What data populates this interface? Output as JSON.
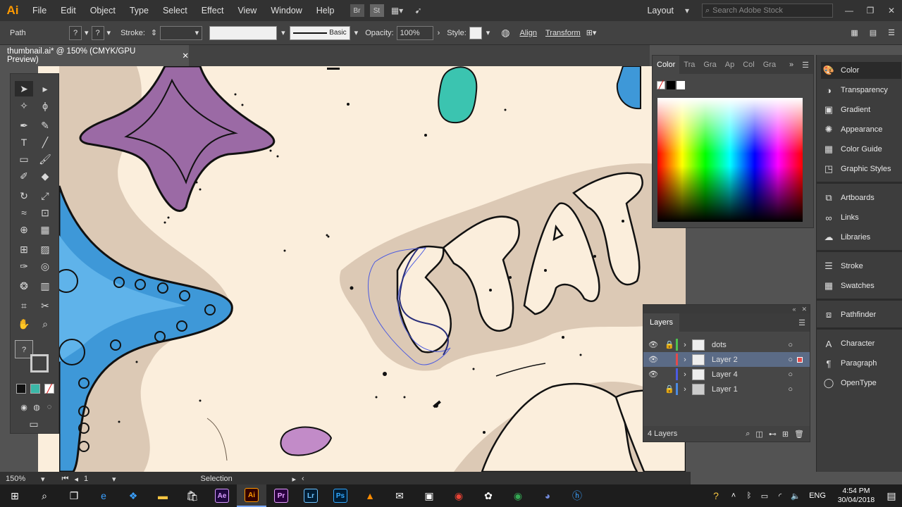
{
  "menubar": {
    "logo": "Ai",
    "items": [
      "File",
      "Edit",
      "Object",
      "Type",
      "Select",
      "Effect",
      "View",
      "Window",
      "Help"
    ],
    "workspace": "Layout",
    "search_placeholder": "Search Adobe Stock",
    "bridge_label": "Br",
    "stock_label": "St"
  },
  "controlbar": {
    "selection_type": "Path",
    "stroke_label": "Stroke:",
    "brush_label": "Basic",
    "opacity_label": "Opacity:",
    "opacity_value": "100%",
    "style_label": "Style:",
    "align_label": "Align",
    "transform_label": "Transform"
  },
  "document": {
    "tab_title": "thumbnail.ai* @ 150% (CMYK/GPU Preview)",
    "close": "✕"
  },
  "color_panel": {
    "tabs": [
      "Color",
      "Tra",
      "Gra",
      "Ap",
      "Col",
      "Gra"
    ]
  },
  "dock": {
    "items": [
      "Color",
      "Transparency",
      "Gradient",
      "Appearance",
      "Color Guide",
      "Graphic Styles",
      "Artboards",
      "Links",
      "Libraries",
      "Stroke",
      "Swatches",
      "Pathfinder",
      "Character",
      "Paragraph",
      "OpenType"
    ]
  },
  "layers_panel": {
    "title": "Layers",
    "layers": [
      {
        "name": "dots",
        "color": "#4fc24f"
      },
      {
        "name": "Layer 2",
        "color": "#e34b4b"
      },
      {
        "name": "Layer 4",
        "color": "#4b5be3"
      },
      {
        "name": "Layer 1",
        "color": "#4b8be3"
      }
    ],
    "count_label": "4 Layers"
  },
  "statusbar": {
    "zoom": "150%",
    "artboard": "1",
    "tool": "Selection"
  },
  "taskbar": {
    "language": "ENG",
    "time": "4:54 PM",
    "date": "30/04/2018",
    "apps": [
      "Ae",
      "Ai",
      "Pr",
      "Lr",
      "Ps"
    ]
  },
  "colors": {
    "canvas_bg": "#fbeedc",
    "sand_shadow": "#dcc9b5",
    "starfish_purple": "#9b6aa5",
    "starfish_blue": "#3e98d8",
    "rock_teal": "#3bc4b0"
  }
}
